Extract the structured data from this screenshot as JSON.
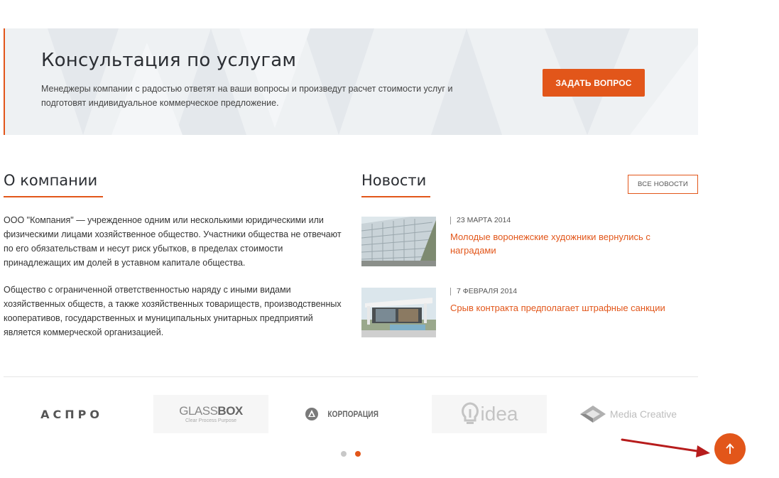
{
  "consult": {
    "title": "Консультация по услугам",
    "text": "Менеджеры компании с радостью ответят на ваши вопросы и произведут расчет стоимости услуг и подготовят индивидуальное коммерческое предложение.",
    "button": "ЗАДАТЬ ВОПРОС"
  },
  "about": {
    "title": "О компании",
    "paragraphs": [
      "ООО \"Компания\" — учрежденное одним или несколькими юридическими или физическими лицами хозяйственное общество. Участники общества не отвечают по его обязательствам и несут риск убытков, в пределах стоимости принадлежащих им долей в уставном капитале общества.",
      "Общество с ограниченной ответственностью наряду с иными видами хозяйственных обществ, а также хозяйственных товариществ, производственных кооперативов, государственных и муниципальных унитарных предприятий является коммерческой организацией."
    ]
  },
  "news": {
    "title": "Новости",
    "all_button": "ВСЕ НОВОСТИ",
    "items": [
      {
        "date": "23 МАРТА 2014",
        "title": "Молодые воронежские художники вернулись с наградами"
      },
      {
        "date": "7 ФЕВРАЛЯ 2014",
        "title": "Срыв контракта предполагает штрафные санкции"
      }
    ]
  },
  "partners": {
    "logos": [
      {
        "name": "АСПРО"
      },
      {
        "name": "GLASS",
        "name_bold": "BOX",
        "tagline": "Clear Process Purpose"
      },
      {
        "name": "КОРПОРАЦИЯ"
      },
      {
        "name": "idea"
      },
      {
        "name": "Media Creative"
      }
    ],
    "active_page": 2,
    "page_count": 2
  },
  "colors": {
    "accent": "#e2561a",
    "banner_bg": "#eef1f3",
    "dot_inactive": "#c8c8c8"
  },
  "icons": {
    "scroll_top": "arrow-up-icon"
  }
}
